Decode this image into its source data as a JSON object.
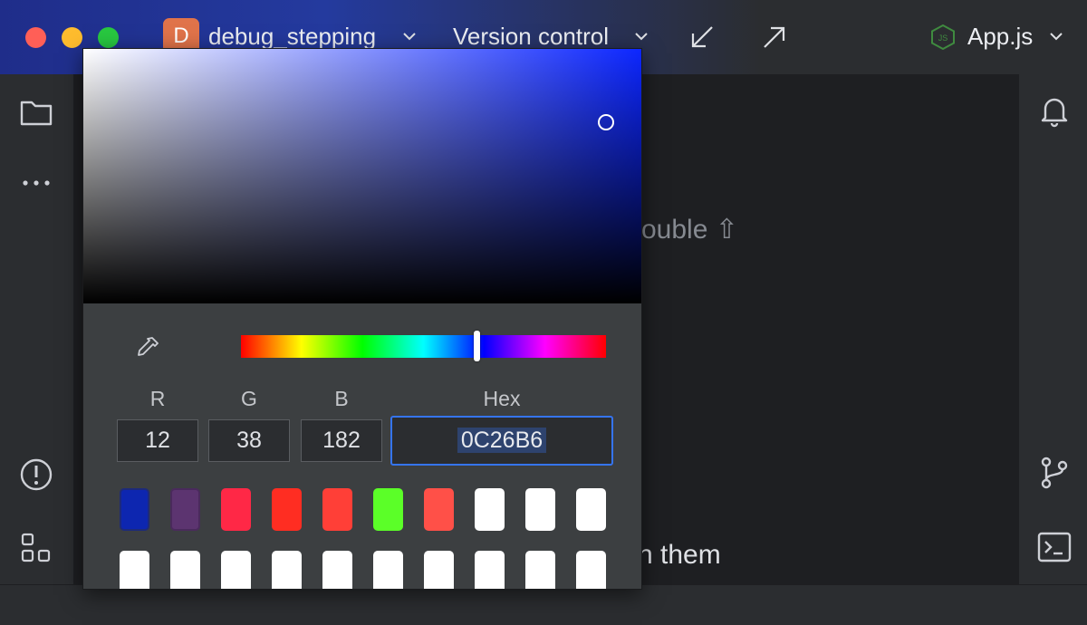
{
  "titlebar": {
    "project_badge": "D",
    "project_name": "debug_stepping",
    "vcs_label": "Version control",
    "file_name": "App.js",
    "brand_color": "#e0734a"
  },
  "editor": {
    "hint_partial_1": "ouble ⇧",
    "hint_partial_2": "n them"
  },
  "picker": {
    "channels": [
      {
        "label": "R",
        "value": "12"
      },
      {
        "label": "G",
        "value": "38"
      },
      {
        "label": "B",
        "value": "182"
      }
    ],
    "hex_label": "Hex",
    "hex_value": "0C26B6",
    "selected_color": "#0c26b6",
    "swatches_row1": [
      "#0d26b0",
      "#5c3470",
      "#ff2846",
      "#ff2d22",
      "#ff3f37",
      "#5bff28",
      "#ff5048",
      "#ffffff",
      "#ffffff",
      "#ffffff"
    ],
    "swatches_row2": [
      "#ffffff",
      "#ffffff",
      "#ffffff",
      "#ffffff",
      "#ffffff",
      "#ffffff",
      "#ffffff",
      "#ffffff",
      "#ffffff",
      "#ffffff"
    ]
  },
  "icons": {
    "left_strip": [
      "folder-icon",
      "more-icon",
      "problems-icon",
      "structure-icon"
    ],
    "right_strip": [
      "notifications-icon",
      "git-branch-icon",
      "terminal-icon"
    ]
  }
}
